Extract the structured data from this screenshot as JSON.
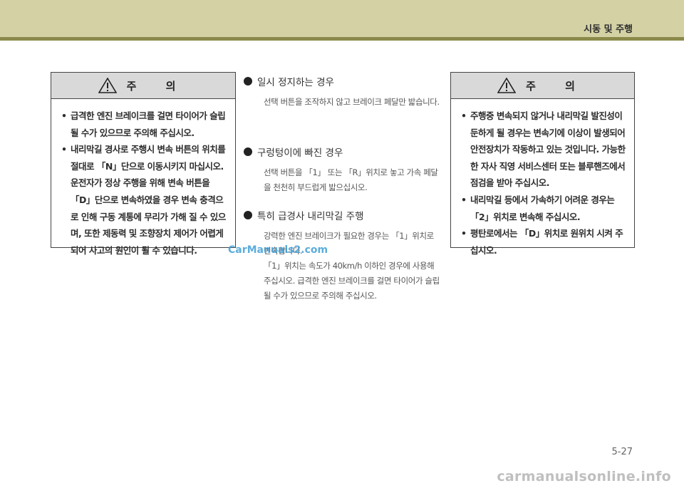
{
  "header": {
    "title": "시동 및 주행"
  },
  "caution_left": {
    "title": "주 의",
    "items": [
      "급격한 엔진 브레이크를 걸면 타이어가 슬립될 수가 있으므로 주의해 주십시오.",
      "내리막길 경사로 주행시 변속 버튼의 위치를 절대로 「N」단으로 이동시키지 마십시오. 운전자가 정상 주행을 위해 변속 버튼을 「D」단으로 변속하였을 경우 변속 충격으로 인해 구동 계통에 무리가 가해 질 수 있으며, 또한 제동력 및 조향장치 제어가 어렵게 되어 사고의 원인이 될 수 있습니다."
    ]
  },
  "sections": [
    {
      "title": "일시 정지하는 경우",
      "body": "선택 버튼을 조작하지 않고 브레이크 페달만 밟습니다."
    },
    {
      "title": "구렁텅이에 빠진 경우",
      "body": "선택 버튼을 「1」 또는 「R」위치로 놓고 가속 페달을 천천히 부드럽게 밟으십시오."
    },
    {
      "title": "특히 급경사 내리막길 주행",
      "body": "강력한 엔진 브레이크가 필요한 경우는 「1」위치로 변속합니다.",
      "body2": "「1」위치는 속도가 40km/h 이하인 경우에 사용해 주십시오. 급격한 엔진 브레이크를 걸면 타이어가 슬립될 수가 있으므로 주의해 주십시오."
    }
  ],
  "caution_right": {
    "title": "주 의",
    "items": [
      "주행중 변속되지 않거나 내리막길 발진성이 둔하게 될 경우는 변속기에 이상이 발생되어 안전장치가 작동하고 있는 것입니다. 가능한한 자사 직영 서비스센터 또는 블루핸즈에서 점검을 받아 주십시오.",
      "내리막길 등에서 가속하기 어려운 경우는 「2」위치로 변속해 주십시오.",
      "평탄로에서는 「D」위치로 원위치 시켜 주십시오."
    ]
  },
  "watermark_top": "CarManuals2.com",
  "watermark_bottom": "carmanualsonline.info",
  "page_number": "5-27"
}
